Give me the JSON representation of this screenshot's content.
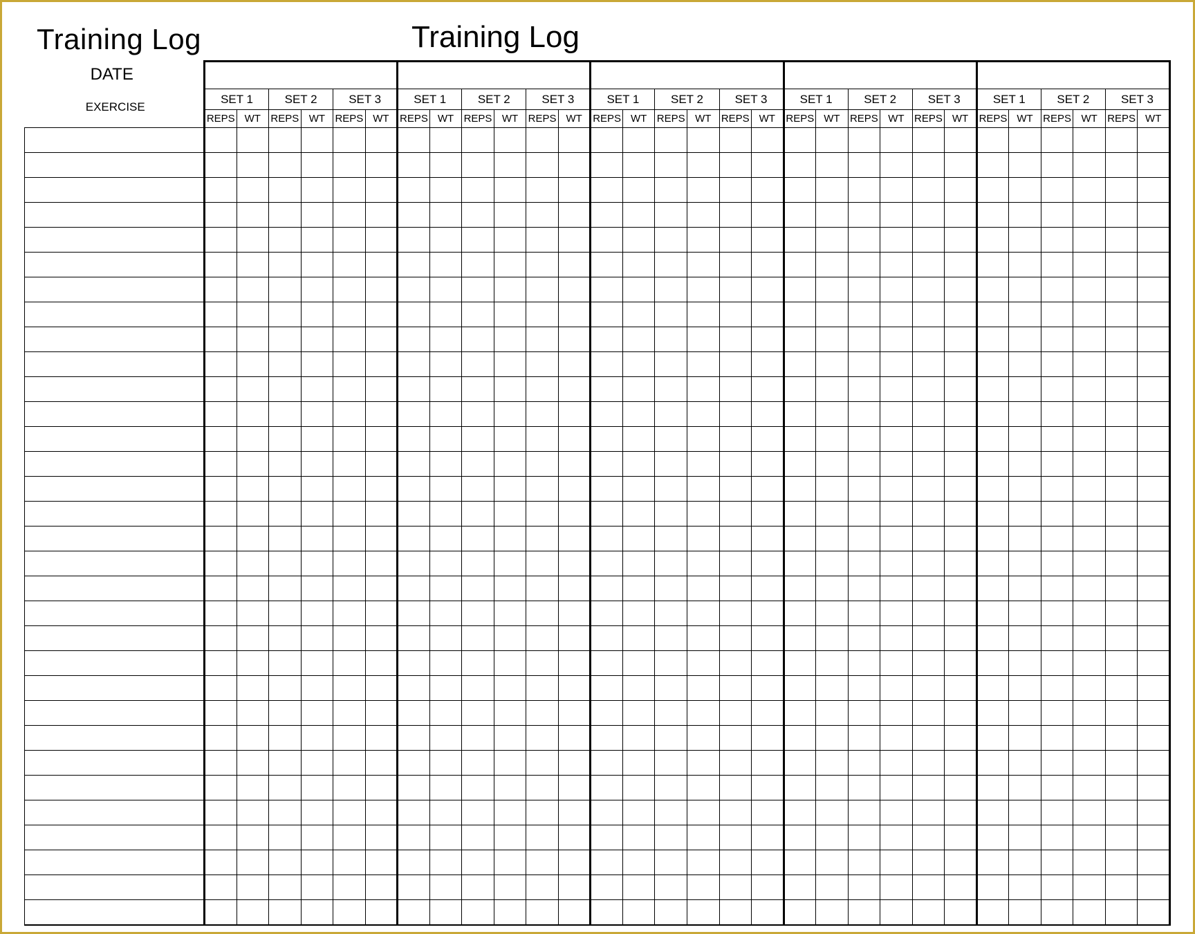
{
  "titles": {
    "left": "Training Log",
    "center": "Training Log"
  },
  "labels": {
    "date": "DATE",
    "exercise": "EXERCISE",
    "set": [
      "SET 1",
      "SET 2",
      "SET 3"
    ],
    "sub": [
      "REPS",
      "WT"
    ]
  },
  "layout": {
    "days": 5,
    "sets_per_day": 3,
    "cols_per_set": 2,
    "body_rows": 32
  }
}
